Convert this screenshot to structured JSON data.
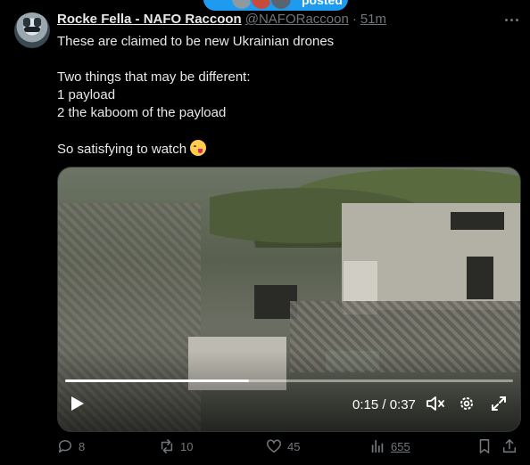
{
  "banner": {
    "label": "posted"
  },
  "tweet": {
    "author_name": "Rocke Fella - NAFO Raccoon",
    "handle": "@NAFORaccoon",
    "separator": "·",
    "time": "51m",
    "lines": [
      "These are claimed to be new Ukrainian drones",
      "",
      "Two things that may be different:",
      "1 payload",
      "2 the kaboom of the payload",
      "",
      "So satisfying to watch"
    ],
    "emoji": "yum-face-emoji"
  },
  "video": {
    "current_time": "0:15",
    "duration": "0:37",
    "timecode": "0:15 / 0:37",
    "progress": 0.41
  },
  "actions": {
    "replies": "8",
    "reposts": "10",
    "likes": "45",
    "views": "655"
  },
  "colors": {
    "accent": "#1d9bf0",
    "muted": "#71767b",
    "text": "#e7e9ea",
    "background": "#000000"
  }
}
